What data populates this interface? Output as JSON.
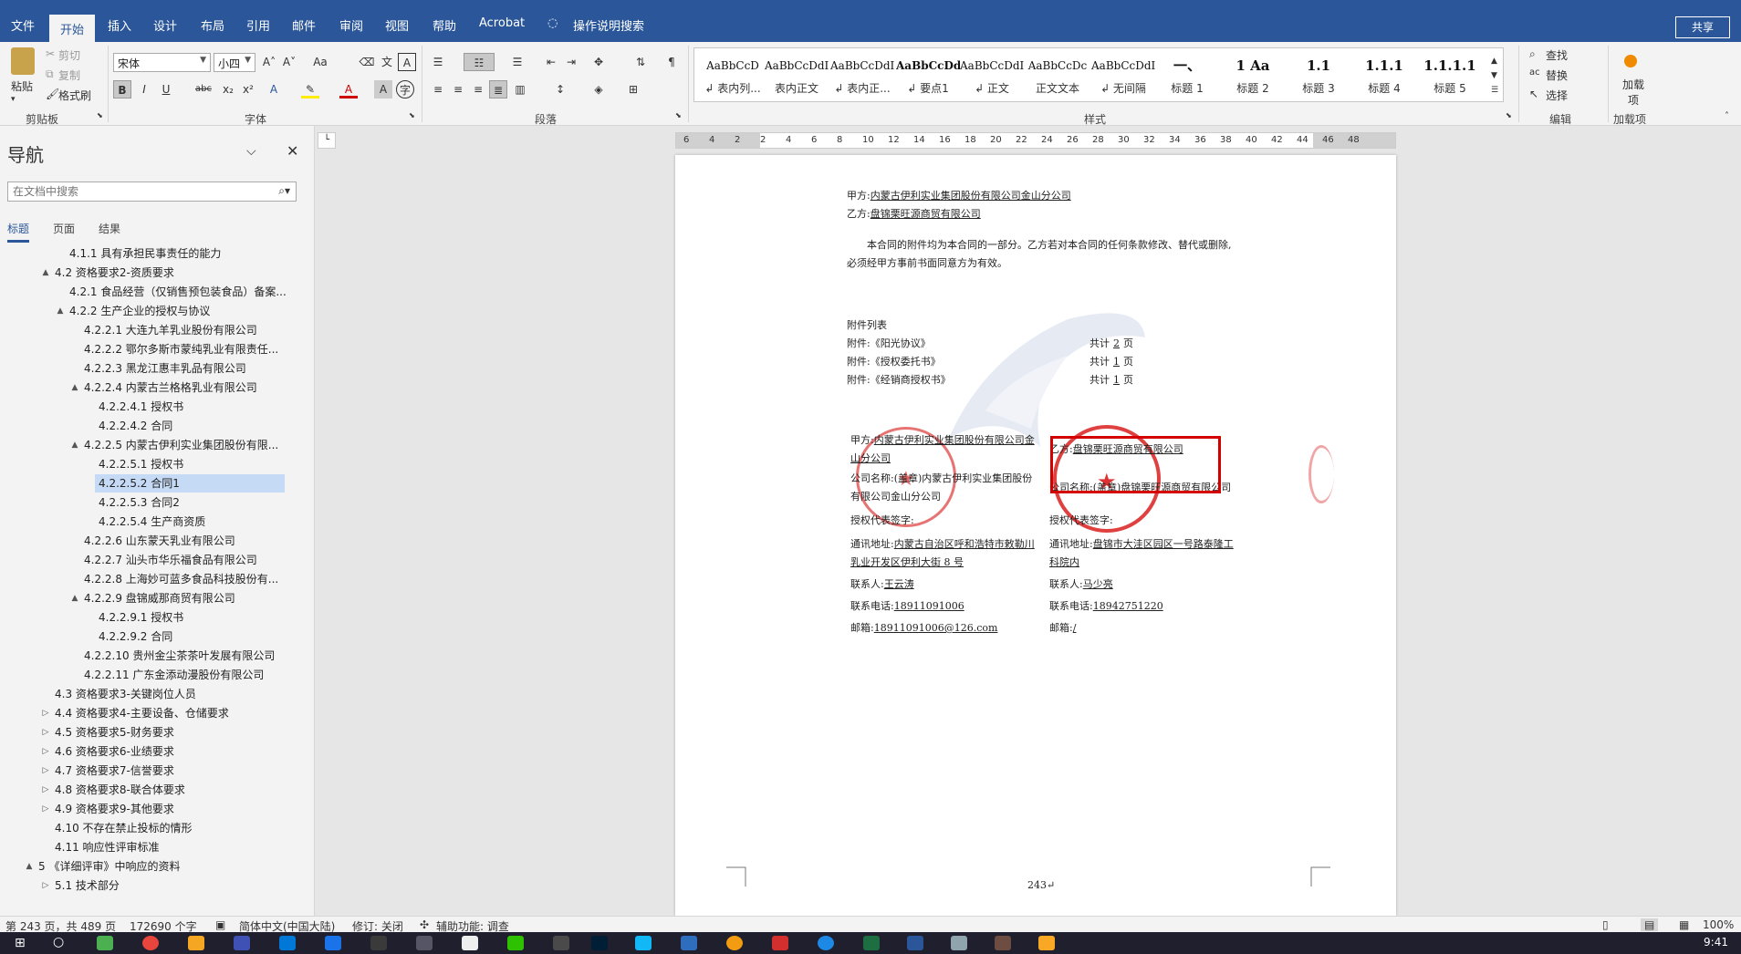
{
  "ribbon_tabs": [
    "文件",
    "开始",
    "插入",
    "设计",
    "布局",
    "引用",
    "邮件",
    "审阅",
    "视图",
    "帮助",
    "Acrobat",
    "操作说明搜索"
  ],
  "share_label": "共享",
  "clipboard": {
    "paste": "粘贴",
    "cut": "剪切",
    "copy": "复制",
    "format_painter": "格式刷",
    "group": "剪贴板"
  },
  "font": {
    "name": "宋体",
    "size": "小四",
    "group": "字体",
    "case_btn": "Aa",
    "bold": "B",
    "italic": "I",
    "underline": "U",
    "strike": "abc",
    "sub": "x₂",
    "sup": "x²"
  },
  "paragraph": {
    "group": "段落"
  },
  "styles": {
    "group": "样式",
    "items": [
      {
        "preview": "AaBbCcD",
        "name": "↲ 表内列..."
      },
      {
        "preview": "AaBbCcDdI",
        "name": "表内正文"
      },
      {
        "preview": "AaBbCcDdI",
        "name": "↲ 表内正..."
      },
      {
        "preview": "AaBbCcDd",
        "name": "↲ 要点1"
      },
      {
        "preview": "AaBbCcDdI",
        "name": "↲ 正文"
      },
      {
        "preview": "AaBbCcDc",
        "name": "正文文本"
      },
      {
        "preview": "AaBbCcDdI",
        "name": "↲ 无间隔"
      },
      {
        "preview": "一、",
        "name": "标题 1"
      },
      {
        "preview": "1  Aa",
        "name": "标题 2"
      },
      {
        "preview": "1.1",
        "name": "标题 3"
      },
      {
        "preview": "1.1.1",
        "name": "标题 4"
      },
      {
        "preview": "1.1.1.1",
        "name": "标题 5"
      }
    ]
  },
  "editing": {
    "find": "查找",
    "replace": "替换",
    "select": "选择",
    "group": "编辑"
  },
  "addins": {
    "label": "加载项",
    "group": "加载项"
  },
  "nav": {
    "title": "导航",
    "search_placeholder": "在文档中搜索",
    "tabs": [
      "标题",
      "页面",
      "结果"
    ],
    "items": [
      {
        "text": "4.1.1 具有承担民事责任的能力",
        "level": 4,
        "arrow": ""
      },
      {
        "text": "4.2 资格要求2-资质要求",
        "level": 3,
        "arrow": "▲"
      },
      {
        "text": "4.2.1 食品经营（仅销售预包装食品）备案...",
        "level": 4,
        "arrow": ""
      },
      {
        "text": "4.2.2 生产企业的授权与协议",
        "level": 4,
        "arrow": "▲"
      },
      {
        "text": "4.2.2.1 大连九羊乳业股份有限公司",
        "level": 5,
        "arrow": ""
      },
      {
        "text": "4.2.2.2 鄂尔多斯市蒙纯乳业有限责任...",
        "level": 5,
        "arrow": ""
      },
      {
        "text": "4.2.2.3 黑龙江惠丰乳品有限公司",
        "level": 5,
        "arrow": ""
      },
      {
        "text": "4.2.2.4 内蒙古兰格格乳业有限公司",
        "level": 5,
        "arrow": "▲"
      },
      {
        "text": "4.2.2.4.1 授权书",
        "level": 6,
        "arrow": ""
      },
      {
        "text": "4.2.2.4.2 合同",
        "level": 6,
        "arrow": ""
      },
      {
        "text": "4.2.2.5 内蒙古伊利实业集团股份有限...",
        "level": 5,
        "arrow": "▲"
      },
      {
        "text": "4.2.2.5.1 授权书",
        "level": 6,
        "arrow": ""
      },
      {
        "text": "4.2.2.5.2 合同1",
        "level": 6,
        "arrow": "",
        "selected": true
      },
      {
        "text": "4.2.2.5.3 合同2",
        "level": 6,
        "arrow": ""
      },
      {
        "text": "4.2.2.5.4 生产商资质",
        "level": 6,
        "arrow": ""
      },
      {
        "text": "4.2.2.6 山东蒙天乳业有限公司",
        "level": 5,
        "arrow": ""
      },
      {
        "text": "4.2.2.7 汕头市华乐福食品有限公司",
        "level": 5,
        "arrow": ""
      },
      {
        "text": "4.2.2.8 上海妙可蓝多食品科技股份有...",
        "level": 5,
        "arrow": ""
      },
      {
        "text": "4.2.2.9 盘锦威那商贸有限公司",
        "level": 5,
        "arrow": "▲"
      },
      {
        "text": "4.2.2.9.1 授权书",
        "level": 6,
        "arrow": ""
      },
      {
        "text": "4.2.2.9.2 合同",
        "level": 6,
        "arrow": ""
      },
      {
        "text": "4.2.2.10 贵州金尘茶茶叶发展有限公司",
        "level": 5,
        "arrow": ""
      },
      {
        "text": "4.2.2.11 广东金添动漫股份有限公司",
        "level": 5,
        "arrow": ""
      },
      {
        "text": "4.3 资格要求3-关键岗位人员",
        "level": 3,
        "arrow": ""
      },
      {
        "text": "4.4 资格要求4-主要设备、仓储要求",
        "level": 3,
        "arrow": "▷"
      },
      {
        "text": "4.5 资格要求5-财务要求",
        "level": 3,
        "arrow": "▷"
      },
      {
        "text": "4.6 资格要求6-业绩要求",
        "level": 3,
        "arrow": "▷"
      },
      {
        "text": "4.7 资格要求7-信誉要求",
        "level": 3,
        "arrow": "▷"
      },
      {
        "text": "4.8 资格要求8-联合体要求",
        "level": 3,
        "arrow": "▷"
      },
      {
        "text": "4.9 资格要求9-其他要求",
        "level": 3,
        "arrow": "▷"
      },
      {
        "text": "4.10 不存在禁止投标的情形",
        "level": 3,
        "arrow": ""
      },
      {
        "text": "4.11 响应性评审标准",
        "level": 3,
        "arrow": ""
      },
      {
        "text": "5 《详细评审》中响应的资料",
        "level": 2,
        "arrow": "▲"
      },
      {
        "text": "5.1 技术部分",
        "level": 3,
        "arrow": "▷"
      }
    ]
  },
  "ruler_numbers": [
    "6",
    "4",
    "2",
    "2",
    "4",
    "6",
    "8",
    "10",
    "12",
    "14",
    "16",
    "18",
    "20",
    "22",
    "24",
    "26",
    "28",
    "30",
    "32",
    "34",
    "36",
    "38",
    "40",
    "42",
    "44",
    "46",
    "48"
  ],
  "document": {
    "party_a_label": "甲方:",
    "party_a": "内蒙古伊利实业集团股份有限公司金山分公司",
    "party_b_label": "乙方:",
    "party_b": "盘锦栗旺源商贸有限公司",
    "body_1": "本合同的附件均为本合同的一部分。乙方若对本合同的任何条款修改、替代或删除,",
    "body_2": "必须经甲方事前书面同意方为有效。",
    "attach_title": "附件列表",
    "attachments": [
      {
        "name": "附件:《阳光协议》",
        "pages_pre": "共计",
        "pages": "2",
        "pages_post": "页"
      },
      {
        "name": "附件:《授权委托书》",
        "pages_pre": "共计",
        "pages": "1",
        "pages_post": "页"
      },
      {
        "name": "附件:《经销商授权书》",
        "pages_pre": "共计",
        "pages": "1",
        "pages_post": "页"
      }
    ],
    "sig_a_label": "甲方:",
    "sig_a_1": "内蒙古伊利实业集团股份有限公司金",
    "sig_a_2": "山分公司",
    "sig_b_label": "乙方:",
    "sig_b": "盘锦栗旺源商贸有限公司",
    "company_a_label": "公司名称:",
    "company_a_1": "(盖章)内蒙古伊利实业集团股份",
    "company_a_2": "有限公司金山分公司",
    "company_b_label": "公司名称:",
    "company_b": "(盖章)盘锦栗旺源商贸有限公司",
    "rep_a": "授权代表签字:",
    "rep_b": "授权代表签字:",
    "addr_a_label": "通讯地址:",
    "addr_a_1": "内蒙古自治区呼和浩特市敕勒川",
    "addr_a_2": "乳业开发区伊利大街 8 号",
    "addr_b_label": "通讯地址:",
    "addr_b_1": "盘锦市大洼区园区一号路泰隆工",
    "addr_b_2": "科院内",
    "contact_a_label": "联系人:",
    "contact_a": "王云涛",
    "contact_b_label": "联系人:",
    "contact_b": "马少亮",
    "phone_a_label": "联系电话:",
    "phone_a": "18911091006",
    "phone_b_label": "联系电话:",
    "phone_b": "18942751220",
    "email_a_label": "邮箱:",
    "email_a": "18911091006@126.com",
    "email_b_label": "邮箱:",
    "email_b": "/",
    "page_number": "243↵"
  },
  "statusbar": {
    "page": "第 243 页，共 489 页",
    "words": "172690 个字",
    "language": "简体中文(中国大陆)",
    "track": "修订: 关闭",
    "accessibility": "辅助功能: 调查",
    "zoom": "100%"
  },
  "clock": "9:41",
  "colors": {
    "word_blue": "#2b579a",
    "seal_red": "#d40000",
    "nav_selected": "#c5daf5"
  }
}
